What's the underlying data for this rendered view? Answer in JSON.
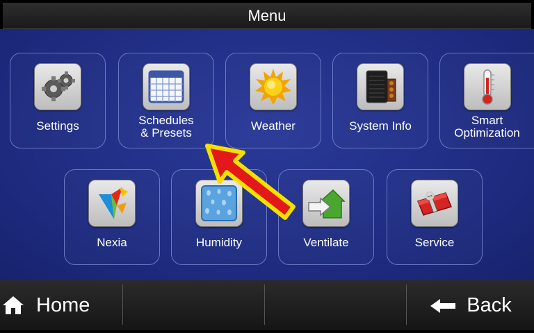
{
  "header": {
    "title": "Menu"
  },
  "tiles": [
    {
      "label": "Settings",
      "icon": "gear-icon"
    },
    {
      "label": "Schedules\n& Presets",
      "icon": "calendar-icon"
    },
    {
      "label": "Weather",
      "icon": "sun-icon"
    },
    {
      "label": "System Info",
      "icon": "hvac-unit-icon"
    },
    {
      "label": "Smart\nOptimization",
      "icon": "thermometer-icon"
    },
    {
      "label": "Nexia",
      "icon": "nexia-logo-icon"
    },
    {
      "label": "Humidity",
      "icon": "water-drops-icon"
    },
    {
      "label": "Ventilate",
      "icon": "ventilate-house-icon"
    },
    {
      "label": "Service",
      "icon": "toolbox-icon"
    }
  ],
  "footer": {
    "home_label": "Home",
    "back_label": "Back"
  },
  "colors": {
    "menu_background": "#1f2e86",
    "tile_border": "#6a78c4",
    "annotation_arrow": "#e3181b",
    "annotation_arrow_outline": "#f5e000"
  }
}
